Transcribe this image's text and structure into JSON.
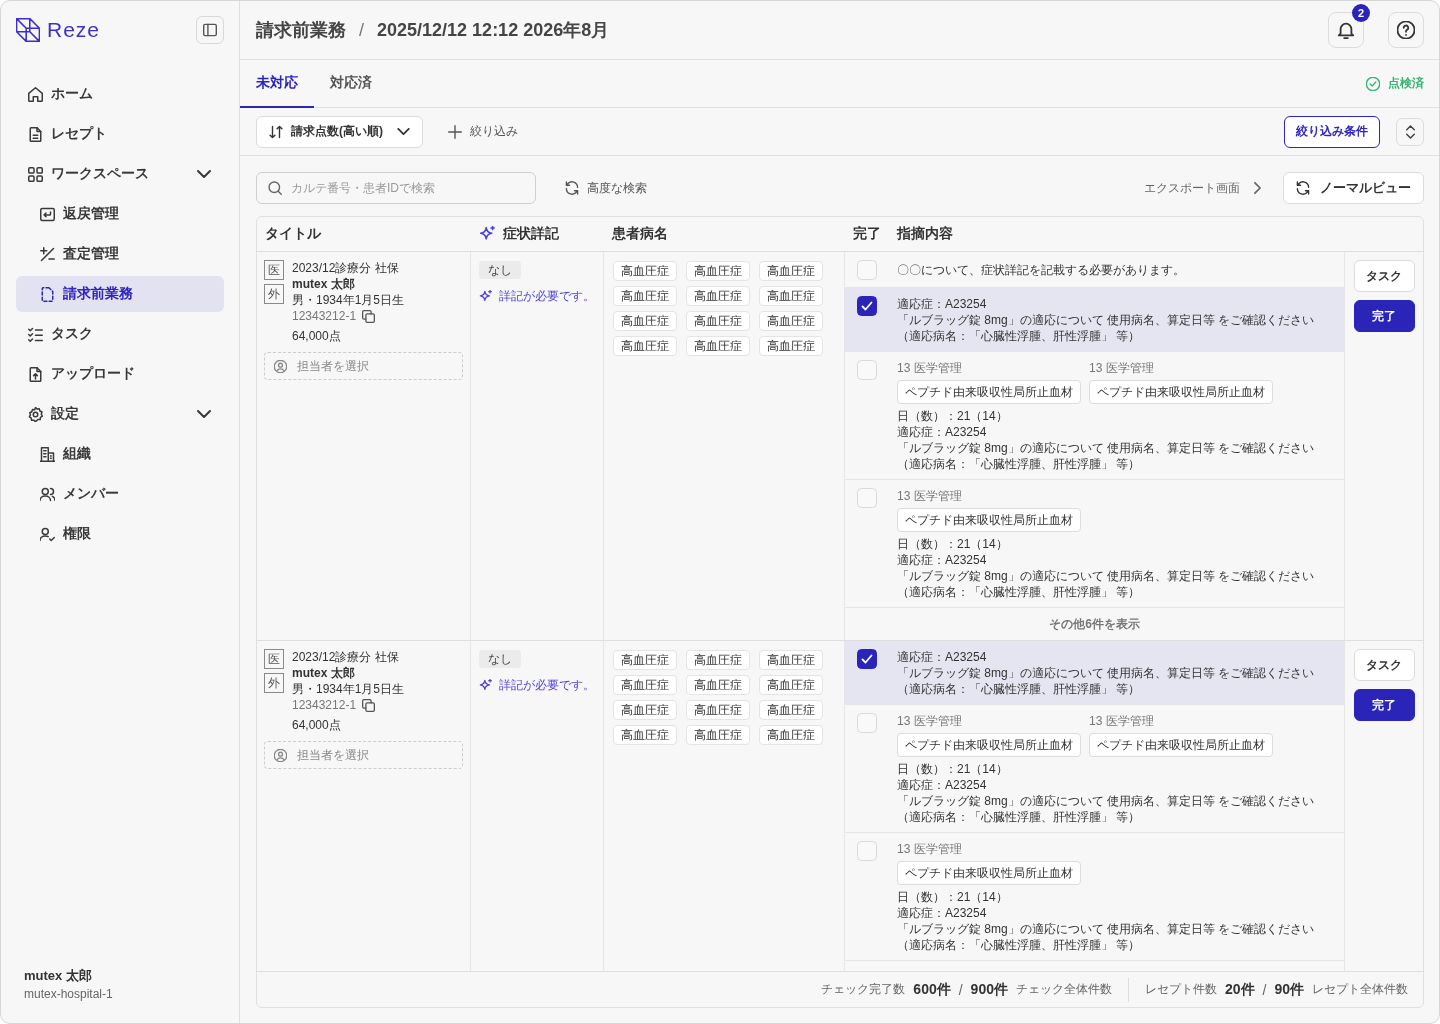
{
  "sidebar": {
    "logo": "Reze",
    "items": [
      {
        "label": "ホーム",
        "selected": false
      },
      {
        "label": "レセプト",
        "selected": false
      },
      {
        "label": "ワークスペース",
        "selected": false,
        "expanded": true,
        "children": [
          {
            "label": "返戻管理",
            "selected": false
          },
          {
            "label": "査定管理",
            "selected": false
          },
          {
            "label": "請求前業務",
            "selected": true
          }
        ]
      },
      {
        "label": "タスク",
        "selected": false
      },
      {
        "label": "アップロード",
        "selected": false
      },
      {
        "label": "設定",
        "selected": false,
        "expanded": true,
        "children": [
          {
            "label": "組織",
            "selected": false
          },
          {
            "label": "メンバー",
            "selected": false
          },
          {
            "label": "権限",
            "selected": false
          }
        ]
      }
    ],
    "user": {
      "name": "mutex 太郎",
      "organization": "mutex-hospital-1"
    }
  },
  "header": {
    "breadcrumb": [
      "請求前業務",
      "2025/12/12 12:12 2026年8月"
    ],
    "separator": "/",
    "notification_count": "2"
  },
  "tabs": [
    {
      "label": "未対応",
      "selected": true
    },
    {
      "label": "対応済",
      "selected": false
    }
  ],
  "review_status": {
    "label": "点検済"
  },
  "toolbar": {
    "sort": {
      "value": "請求点数(高い順)"
    },
    "add_filter": "絞り込み",
    "filter_conditions": "絞り込み条件"
  },
  "search": {
    "placeholder": "カルテ番号・患者IDで検索",
    "advanced_search": "高度な検索",
    "export_link": "エクスポート画面",
    "view_button": "ノーマルビュー"
  },
  "table": {
    "columns": [
      {
        "label": "タイトル",
        "kind": "plain"
      },
      {
        "label": "症状詳記",
        "kind": "ai"
      },
      {
        "label": "患者病名",
        "kind": "plain"
      },
      {
        "label": "完了",
        "kind": "plain"
      },
      {
        "label": "指摘内容",
        "kind": "plain"
      }
    ],
    "rows": [
      {
        "badges": [
          "医",
          "外"
        ],
        "period": "2023/12診療分 社保",
        "patient": "mutex 太郎",
        "profile": "男・1934年1月5日生",
        "chart_number": "12343212-1",
        "points": "64,000点",
        "assignee_placeholder": "担当者を選択",
        "symptom": {
          "status": "なし",
          "note": "詳記が必要です。"
        },
        "diseases": [
          "高血圧症",
          "高血圧症",
          "高血圧症",
          "高血圧症",
          "高血圧症",
          "高血圧症",
          "高血圧症",
          "高血圧症",
          "高血圧症",
          "高血圧症",
          "高血圧症",
          "高血圧症"
        ],
        "checks": [
          {
            "checked": false,
            "lines": [
              "〇〇について、症状詳記を記載する必要があります。"
            ]
          },
          {
            "checked": true,
            "lines": [
              "適応症：A23254",
              "「ルブラッグ錠 8mg」の適応について 使用病名、算定日等 をご確認ください",
              "（適応病名：「心臓性浮腫、肝性浮腫」 等）"
            ]
          },
          {
            "checked": false,
            "groups": [
              {
                "category": "13 医学管理",
                "item": "ペプチド由来吸収性局所止血材"
              },
              {
                "category": "13 医学管理",
                "item": "ペプチド由来吸収性局所止血材"
              }
            ],
            "lines": [
              "日（数）：21（14）",
              "適応症：A23254",
              "「ルブラッグ錠 8mg」の適応について 使用病名、算定日等 をご確認ください",
              "（適応病名：「心臓性浮腫、肝性浮腫」 等）"
            ]
          },
          {
            "checked": false,
            "groups": [
              {
                "category": "13 医学管理",
                "item": "ペプチド由来吸収性局所止血材"
              }
            ],
            "lines": [
              "日（数）：21（14）",
              "適応症：A23254",
              "「ルブラッグ錠 8mg」の適応について 使用病名、算定日等 をご確認ください",
              "（適応病名：「心臓性浮腫、肝性浮腫」 等）"
            ]
          }
        ],
        "show_more": "その他6件を表示",
        "actions": [
          {
            "label": "タスク",
            "kind": "secondary"
          },
          {
            "label": "完了",
            "kind": "primary"
          }
        ]
      },
      {
        "badges": [
          "医",
          "外"
        ],
        "period": "2023/12診療分 社保",
        "patient": "mutex 太郎",
        "profile": "男・1934年1月5日生",
        "chart_number": "12343212-1",
        "points": "64,000点",
        "assignee_placeholder": "担当者を選択",
        "symptom": {
          "status": "なし",
          "note": "詳記が必要です。"
        },
        "diseases": [
          "高血圧症",
          "高血圧症",
          "高血圧症",
          "高血圧症",
          "高血圧症",
          "高血圧症",
          "高血圧症",
          "高血圧症",
          "高血圧症",
          "高血圧症",
          "高血圧症",
          "高血圧症"
        ],
        "checks": [
          {
            "checked": true,
            "lines": [
              "適応症：A23254",
              "「ルブラッグ錠 8mg」の適応について 使用病名、算定日等 をご確認ください",
              "（適応病名：「心臓性浮腫、肝性浮腫」 等）"
            ]
          },
          {
            "checked": false,
            "groups": [
              {
                "category": "13 医学管理",
                "item": "ペプチド由来吸収性局所止血材"
              },
              {
                "category": "13 医学管理",
                "item": "ペプチド由来吸収性局所止血材"
              }
            ],
            "lines": [
              "日（数）：21（14）",
              "適応症：A23254",
              "「ルブラッグ錠 8mg」の適応について 使用病名、算定日等 をご確認ください",
              "（適応病名：「心臓性浮腫、肝性浮腫」 等）"
            ]
          },
          {
            "checked": false,
            "groups": [
              {
                "category": "13 医学管理",
                "item": "ペプチド由来吸収性局所止血材"
              }
            ],
            "lines": [
              "日（数）：21（14）",
              "適応症：A23254",
              "「ルブラッグ錠 8mg」の適応について 使用病名、算定日等 をご確認ください",
              "（適応病名：「心臓性浮腫、肝性浮腫」 等）"
            ]
          }
        ],
        "actions": [
          {
            "label": "タスク",
            "kind": "secondary"
          },
          {
            "label": "完了",
            "kind": "primary"
          }
        ]
      }
    ],
    "footer": [
      {
        "label": "チェック完了数",
        "count": "600件",
        "separator": "/",
        "total": "900件",
        "total_label": "チェック全体件数"
      },
      {
        "label": "レセプト件数",
        "count": "20件",
        "separator": "/",
        "total": "90件",
        "total_label": "レセプト全体件数"
      }
    ]
  }
}
